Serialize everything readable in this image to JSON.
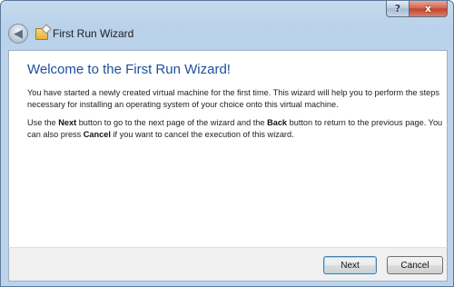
{
  "window": {
    "title": "First Run Wizard",
    "caption": {
      "help": "?",
      "close": "x"
    }
  },
  "wizard": {
    "heading": "Welcome to the First Run Wizard!",
    "intro": "You have started a newly created virtual machine for the first time. This wizard will help you to perform the steps necessary for installing an operating system of your choice onto this virtual machine.",
    "instructions": {
      "t1": "Use the ",
      "next_word": "Next",
      "t2": " button to go to the next page of the wizard and the ",
      "back_word": "Back",
      "t3": " button to return to the previous page. You can also press ",
      "cancel_word": "Cancel",
      "t4": " if you want to cancel the execution of this wizard."
    }
  },
  "footer": {
    "next_label": "Next",
    "cancel_label": "Cancel"
  },
  "icons": {
    "back": "back-arrow-icon",
    "app": "wizard-app-icon"
  }
}
